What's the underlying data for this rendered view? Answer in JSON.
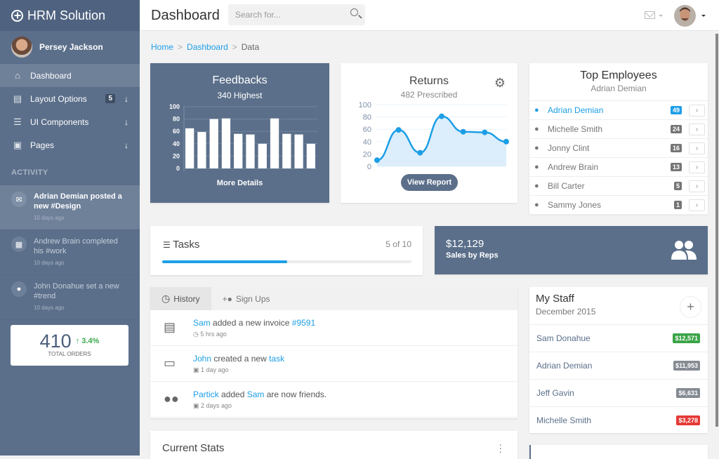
{
  "brand": {
    "name": "HRM Solution",
    "icon": "plus-circle-icon"
  },
  "user": {
    "name": "Persey Jackson"
  },
  "sidebar": {
    "items": [
      {
        "label": "Dashboard",
        "icon": "home-icon",
        "active": true
      },
      {
        "label": "Layout Options",
        "icon": "layout-icon",
        "badge": "5"
      },
      {
        "label": "UI Components",
        "icon": "sliders-icon"
      },
      {
        "label": "Pages",
        "icon": "clipboard-icon"
      }
    ],
    "activity_title": "ACTIVITY",
    "activity": [
      {
        "text": "Adrian Demian posted a new #Design",
        "time": "10 days ago",
        "icon": "mail-icon"
      },
      {
        "text": "Andrew Brain completed his #work",
        "time": "10 days ago",
        "icon": "calendar-icon"
      },
      {
        "text": "John Donahue set a new #trend",
        "time": "10 days ago",
        "icon": "person-icon"
      }
    ],
    "orders": {
      "value": "410",
      "change": "↑ 3.4%",
      "label": "TOTAL ORDERS"
    }
  },
  "topbar": {
    "title": "Dashboard",
    "search_placeholder": "Search for..."
  },
  "breadcrumb": {
    "home": "Home",
    "dashboard": "Dashboard",
    "current": "Data",
    "sep": ">"
  },
  "feedbacks": {
    "title": "Feedbacks",
    "subtitle": "340 Highest",
    "link": "More Details"
  },
  "returns": {
    "title": "Returns",
    "subtitle": "482 Prescribed",
    "button": "View Report"
  },
  "chart_data": [
    {
      "type": "bar",
      "title": "Feedbacks",
      "ylim": [
        0,
        100
      ],
      "yticks": [
        0,
        20,
        40,
        60,
        80,
        100
      ],
      "values": [
        65,
        59,
        80,
        81,
        56,
        55,
        40,
        81,
        56,
        55,
        40
      ]
    },
    {
      "type": "area",
      "title": "Returns",
      "ylim": [
        0,
        100
      ],
      "yticks": [
        0,
        20,
        40,
        60,
        80,
        100
      ],
      "values": [
        10,
        59,
        22,
        81,
        56,
        55,
        40
      ]
    }
  ],
  "top_employees": {
    "title": "Top Employees",
    "subtitle": "Adrian Demian",
    "items": [
      {
        "name": "Adrian Demian",
        "count": "49",
        "highlight": true
      },
      {
        "name": "Michelle Smith",
        "count": "24"
      },
      {
        "name": "Jonny Clint",
        "count": "16"
      },
      {
        "name": "Andrew Brain",
        "count": "13"
      },
      {
        "name": "Bill Carter",
        "count": "5"
      },
      {
        "name": "Sammy Jones",
        "count": "1"
      }
    ]
  },
  "tasks": {
    "title": "Tasks",
    "count": "5 of 10",
    "progress": 0.5
  },
  "sales": {
    "value": "$12,129",
    "label": "Sales by Reps"
  },
  "history": {
    "tabs": [
      "History",
      "Sign Ups"
    ],
    "items": [
      {
        "parts": [
          [
            "Sam",
            true
          ],
          [
            " added a new invoice ",
            false
          ],
          [
            "#9591",
            true
          ]
        ],
        "time": "5 hrs ago"
      },
      {
        "parts": [
          [
            "John",
            true
          ],
          [
            " created a new ",
            false
          ],
          [
            "task",
            true
          ]
        ],
        "time": "1 day ago"
      },
      {
        "parts": [
          [
            "Partick",
            true
          ],
          [
            " added ",
            false
          ],
          [
            "Sam",
            true
          ],
          [
            " are now friends.",
            false
          ]
        ],
        "time": "2 days ago"
      }
    ]
  },
  "staff": {
    "title": "My Staff",
    "subtitle": "December 2015",
    "items": [
      {
        "name": "Sam Donahue",
        "amount": "$12,571",
        "color": "#3aa447"
      },
      {
        "name": "Adrian Demian",
        "amount": "$11,953",
        "color": "#858b92"
      },
      {
        "name": "Jeff Gavin",
        "amount": "$6,631",
        "color": "#858b92"
      },
      {
        "name": "Michelle Smith",
        "amount": "$3,278",
        "color": "#e53935"
      }
    ]
  },
  "stats": {
    "title": "Current Stats"
  }
}
